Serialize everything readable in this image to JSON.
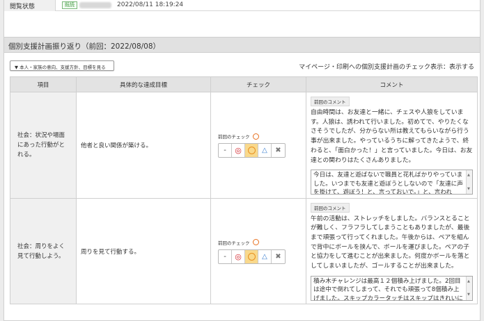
{
  "status": {
    "label": "閲覧状態",
    "badge": "既読",
    "datetime": "2022/08/11 18:19:24"
  },
  "section": {
    "title": "個別支援計画振り返り（前回：2022/08/08）",
    "toggle_label": "▼ 本人・家族の意向、支援方針、目標を見る",
    "display_setting": "マイページ・印刷への個別支援計画のチェック表示：表示する"
  },
  "table": {
    "headers": [
      "項目",
      "具体的な達成目標",
      "チェック",
      "コメント"
    ],
    "rows": [
      {
        "item": "社会：状況や場面にあった行動がとれる。",
        "goal": "他者と良い関係が築ける。",
        "prev_check_label": "前回のチェック",
        "prev_comment_label": "前回のコメント",
        "prev_comment": "自由時間は、お友達と一緒に、チェスや人狼をしています。人狼は、誘われて行いました。初めてで、やりたくなさそうでしたが、分からない所は教えてもらいながら行う事が出来ました。やっているうちに解ってきたようで、終わると、「面白かった！」と言っていました。今日は、お友達との関わりはたくさんありました。",
        "comment": "今日は、友達と遊ばないで職員と花札ばかりやっていました。いつまでも友達と遊ぼうとしないので「友達に声を掛けて、遊ぼう！と、言っておいで。」と、言われ"
      },
      {
        "item": "社会：周りをよく見て行動しよう。",
        "goal": "周りを見て行動する。",
        "prev_check_label": "前回のチェック",
        "prev_comment_label": "前回のコメント",
        "prev_comment": "午前の活動は、ストレッチをしました。バランスとることが難しく、フラフラしてしまうこともありましたが、最後まで頑張って行ってくれました。午後からは、ペアを組んで背中にボールを挟んで、ボールを運びました。ペアの子と協力をして進むことが出来ました。何度かボールを落としてしまいましたが、ゴールすることが出来ました。",
        "comment": "積み木チャレンジは最高１２個積み上げました。2回目は途中で倒れてしまって、それでも頑張って8個積み上げました。スキップカラータッチはスキップはきれいに"
      }
    ]
  },
  "eval_options": {
    "none": "-",
    "excellent": "◎",
    "good": "",
    "fair": "△",
    "poor": "✖"
  },
  "colors": {
    "selected_bg": "#f9d98c",
    "header_bg": "#e1e1e1",
    "read_badge": "#3f9a3f"
  }
}
